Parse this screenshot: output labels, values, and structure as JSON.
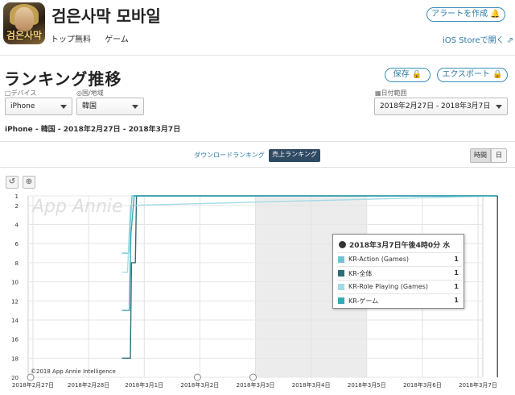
{
  "app": {
    "title": "검은사막 모바일",
    "icon_text": "검은사막",
    "rank_type": "トップ無料",
    "category": "ゲーム",
    "alert_button": "アラートを作成",
    "ios_store_link": "iOS Storeで開く"
  },
  "section": {
    "title": "ランキング推移",
    "save_button": "保存",
    "export_button": "エクスポート"
  },
  "filters": {
    "device_label": "デバイス",
    "device_value": "iPhone",
    "country_label": "国/地域",
    "country_value": "韓国",
    "date_label": "日付範囲",
    "date_value": "2018年2月27日 - 2018年3月7日"
  },
  "summary": "iPhone - 韓国 - 2018年2月27日 - 2018年3月7日",
  "tabs": {
    "downloads": "ダウンロードランキング",
    "sales": "売上ランキング"
  },
  "granularity": {
    "hour": "時間",
    "day": "日"
  },
  "tools": {
    "reset": "↺",
    "zoom": "⊕"
  },
  "watermark": "App Annie",
  "copyright": "©2018 App Annie Intelligence",
  "colors": {
    "kr_action": "#6bc4d6",
    "kr_all": "#2e6f77",
    "kr_rpg": "#a3dbe6",
    "kr_game": "#3aa7b5",
    "shaded_band": "#ececec"
  },
  "tooltip": {
    "title": "2018年3月7日午後4時0分 水",
    "rows": [
      {
        "name": "KR-Action (Games)",
        "value": "1"
      },
      {
        "name": "KR-全体",
        "value": "1"
      },
      {
        "name": "KR-Role Playing (Games)",
        "value": "1"
      },
      {
        "name": "KR-ゲーム",
        "value": "1"
      }
    ]
  },
  "chart_data": {
    "type": "line",
    "ylabel": "",
    "ylim": [
      1,
      20
    ],
    "y_reversed": true,
    "y_ticks": [
      "1",
      "2",
      "4",
      "6",
      "8",
      "10",
      "12",
      "14",
      "16",
      "18",
      "20"
    ],
    "x_ticks": [
      "2018年2月27日",
      "2018年2月28日",
      "2018年3月1日",
      "2018年3月2日",
      "2018年3月3日",
      "2018年3月4日",
      "2018年3月5日",
      "2018年3月6日",
      "2018年3月7日"
    ],
    "shaded_range": [
      "2018年3月3日",
      "2018年3月4日"
    ],
    "series": [
      {
        "name": "KR-Action (Games)",
        "points": [
          [
            1.6,
            7
          ],
          [
            1.72,
            7
          ],
          [
            1.78,
            1
          ],
          [
            8.35,
            1
          ]
        ]
      },
      {
        "name": "KR-全体",
        "points": [
          [
            1.6,
            18
          ],
          [
            1.75,
            18
          ],
          [
            1.77,
            8
          ],
          [
            1.84,
            8
          ],
          [
            1.86,
            1
          ],
          [
            8.35,
            1
          ]
        ]
      },
      {
        "name": "KR-Role Playing (Games)",
        "points": [
          [
            1.6,
            9
          ],
          [
            1.7,
            9
          ],
          [
            1.75,
            2
          ],
          [
            8.35,
            1
          ]
        ]
      },
      {
        "name": "KR-ゲーム",
        "points": [
          [
            1.6,
            13
          ],
          [
            1.73,
            13
          ],
          [
            1.76,
            5
          ],
          [
            1.82,
            1
          ],
          [
            8.35,
            1
          ]
        ]
      }
    ]
  }
}
